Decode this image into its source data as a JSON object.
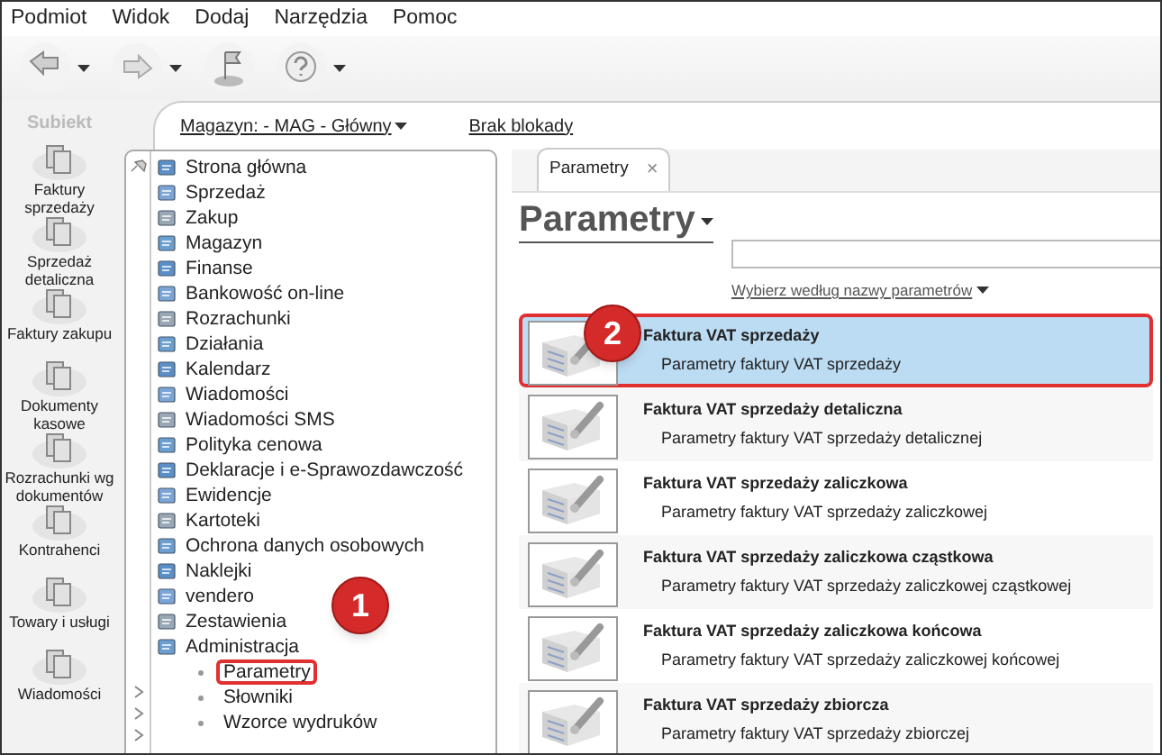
{
  "menu_bar": [
    "Podmiot",
    "Widok",
    "Dodaj",
    "Narzędzia",
    "Pomoc"
  ],
  "toolbar": [
    {
      "kind": "back",
      "has_dropdown": true
    },
    {
      "kind": "forward",
      "has_dropdown": true
    },
    {
      "kind": "flag",
      "has_dropdown": false
    },
    {
      "kind": "help",
      "has_dropdown": true
    }
  ],
  "logo": "Subiekt",
  "sidebar": {
    "items": [
      {
        "label": "Faktury sprzedaży"
      },
      {
        "label": "Sprzedaż detaliczna"
      },
      {
        "label": "Faktury zakupu"
      },
      {
        "label": "Dokumenty kasowe"
      },
      {
        "label": "Rozrachunki wg dokumentów"
      },
      {
        "label": "Kontrahenci"
      },
      {
        "label": "Towary i usługi"
      },
      {
        "label": "Wiadomości"
      }
    ]
  },
  "header": {
    "warehouse": "Magazyn: - MAG - Główny",
    "lock": "Brak blokady"
  },
  "nav_menu": {
    "callout": "1",
    "items": [
      {
        "label": "Strona główna"
      },
      {
        "label": "Sprzedaż"
      },
      {
        "label": "Zakup"
      },
      {
        "label": "Magazyn"
      },
      {
        "label": "Finanse"
      },
      {
        "label": "Bankowość on-line"
      },
      {
        "label": "Rozrachunki"
      },
      {
        "label": "Działania"
      },
      {
        "label": "Kalendarz"
      },
      {
        "label": "Wiadomości"
      },
      {
        "label": "Wiadomości SMS"
      },
      {
        "label": "Polityka cenowa"
      },
      {
        "label": "Deklaracje i e-Sprawozdawczość"
      },
      {
        "label": "Ewidencje"
      },
      {
        "label": "Kartoteki"
      },
      {
        "label": "Ochrona danych osobowych"
      },
      {
        "label": "Naklejki"
      },
      {
        "label": "vendero"
      },
      {
        "label": "Zestawienia"
      },
      {
        "label": "Administracja",
        "children": [
          {
            "label": "Parametry",
            "selected": true
          },
          {
            "label": "Słowniki",
            "selected": false
          },
          {
            "label": "Wzorce wydruków",
            "selected": false
          }
        ]
      }
    ]
  },
  "tabs": [
    {
      "label": "Parametry",
      "selected": true,
      "close": "×"
    }
  ],
  "page": {
    "title": "Parametry",
    "filter_link": "Wybierz według nazwy parametrów",
    "callout": "2"
  },
  "items": [
    {
      "title": "Faktura VAT sprzedaży",
      "description": "Parametry faktury VAT sprzedaży",
      "selected": true
    },
    {
      "title": "Faktura VAT sprzedaży detaliczna",
      "description": "Parametry faktury VAT sprzedaży detalicznej",
      "selected": false
    },
    {
      "title": "Faktura VAT sprzedaży zaliczkowa",
      "description": "Parametry faktury VAT sprzedaży zaliczkowej",
      "selected": false
    },
    {
      "title": "Faktura VAT sprzedaży zaliczkowa cząstkowa",
      "description": "Parametry faktury VAT sprzedaży zaliczkowej cząstkowej",
      "selected": false
    },
    {
      "title": "Faktura VAT sprzedaży zaliczkowa końcowa",
      "description": "Parametry faktury VAT sprzedaży zaliczkowej końcowej",
      "selected": false
    },
    {
      "title": "Faktura VAT sprzedaży zbiorcza",
      "description": "Parametry faktury VAT sprzedaży zbiorczej",
      "selected": false
    }
  ]
}
